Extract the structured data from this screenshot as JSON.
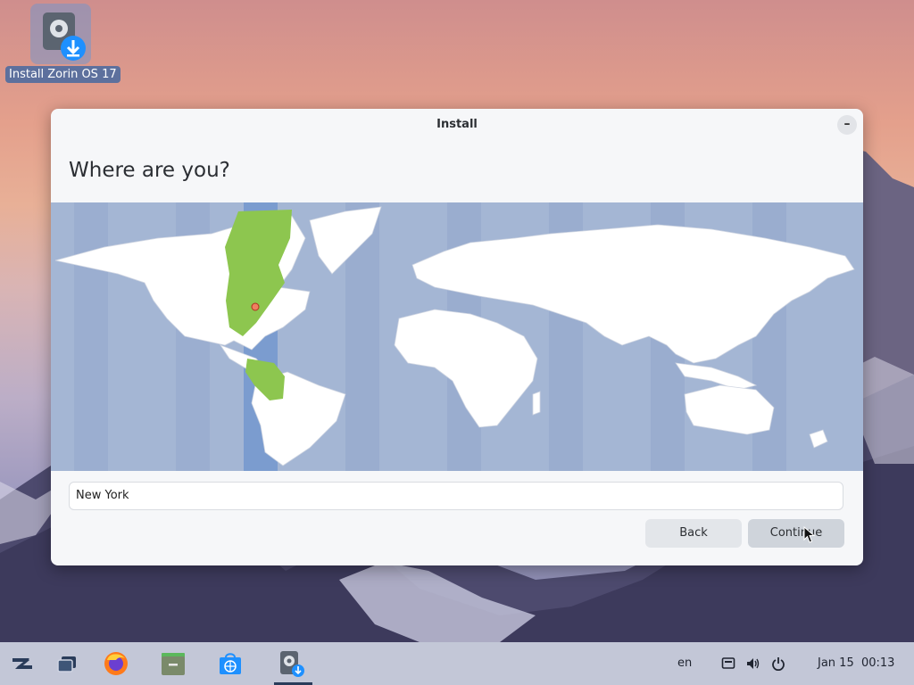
{
  "desktop": {
    "install_icon": {
      "label": "Install Zorin OS 17",
      "icon": "installer-disk-download-icon"
    }
  },
  "window": {
    "title": "Install",
    "minimize_label": "–",
    "heading": "Where are you?",
    "map": {
      "selected_city": "New York",
      "highlight_color": "#8dc64f",
      "timezone_band_color": "#7b9ccf",
      "ocean_color": "#a4b6d4",
      "land_color": "#ffffff"
    },
    "location_field": {
      "value": "New York"
    },
    "buttons": {
      "back": "Back",
      "continue": "Continue"
    }
  },
  "taskbar": {
    "items": [
      {
        "name": "zorin-menu-icon"
      },
      {
        "name": "workspaces-icon"
      },
      {
        "name": "firefox-icon"
      },
      {
        "name": "files-icon"
      },
      {
        "name": "software-store-icon"
      },
      {
        "name": "installer-icon",
        "active": true
      }
    ],
    "keyboard_layout": "en",
    "tray_icons": [
      "network-icon",
      "volume-icon",
      "power-icon"
    ],
    "date": "Jan 15",
    "time": "00:13"
  }
}
